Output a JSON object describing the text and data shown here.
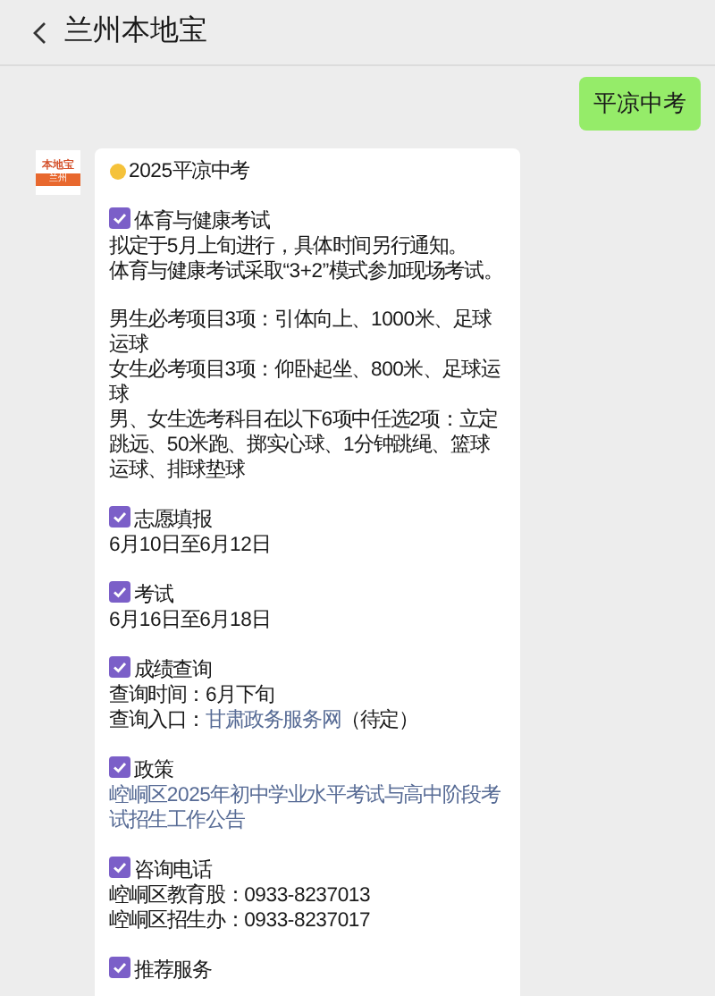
{
  "header": {
    "title": "兰州本地宝"
  },
  "messages": [
    {
      "kind": "outgoing",
      "text": "平凉中考"
    }
  ],
  "card": {
    "avatar": {
      "brand": "本地宝",
      "city": "兰州"
    },
    "title": "2025平凉中考",
    "sections": [
      {
        "heading": "体育与健康考试",
        "paragraphs": [
          [
            [
              {
                "text": "拟定于5月上旬进行，具体时间另行通知。",
                "link": false
              }
            ],
            [
              {
                "text": "体育与健康考试采取“3+2”模式参加现场考试。",
                "link": false
              }
            ]
          ],
          [
            [
              {
                "text": "男生必考项目3项：引体向上、1000米、足球运球",
                "link": false
              }
            ],
            [
              {
                "text": "女生必考项目3项：仰卧起坐、800米、足球运球",
                "link": false
              }
            ],
            [
              {
                "text": "男、女生选考科目在以下6项中任选2项：立定跳远、50米跑、掷实心球、1分钟跳绳、篮球运球、排球垫球",
                "link": false
              }
            ]
          ]
        ]
      },
      {
        "heading": "志愿填报",
        "paragraphs": [
          [
            [
              {
                "text": "6月10日至6月12日",
                "link": false
              }
            ]
          ]
        ]
      },
      {
        "heading": "考试",
        "paragraphs": [
          [
            [
              {
                "text": "6月16日至6月18日",
                "link": false
              }
            ]
          ]
        ]
      },
      {
        "heading": "成绩查询",
        "paragraphs": [
          [
            [
              {
                "text": "查询时间：6月下旬",
                "link": false
              }
            ],
            [
              {
                "text": "查询入口：",
                "link": false
              },
              {
                "text": "甘肃政务服务网",
                "link": true
              },
              {
                "text": "（待定）",
                "link": false
              }
            ]
          ]
        ]
      },
      {
        "heading": "政策",
        "paragraphs": [
          [
            [
              {
                "text": "崆峒区2025年初中学业水平考试与高中阶段考试招生工作公告",
                "link": true
              }
            ]
          ]
        ]
      },
      {
        "heading": "咨询电话",
        "paragraphs": [
          [
            [
              {
                "text": "崆峒区教育股：0933-8237013",
                "link": false
              }
            ],
            [
              {
                "text": "崆峒区招生办：0933-8237017",
                "link": false
              }
            ]
          ]
        ]
      },
      {
        "heading": "推荐服务"
      }
    ]
  }
}
